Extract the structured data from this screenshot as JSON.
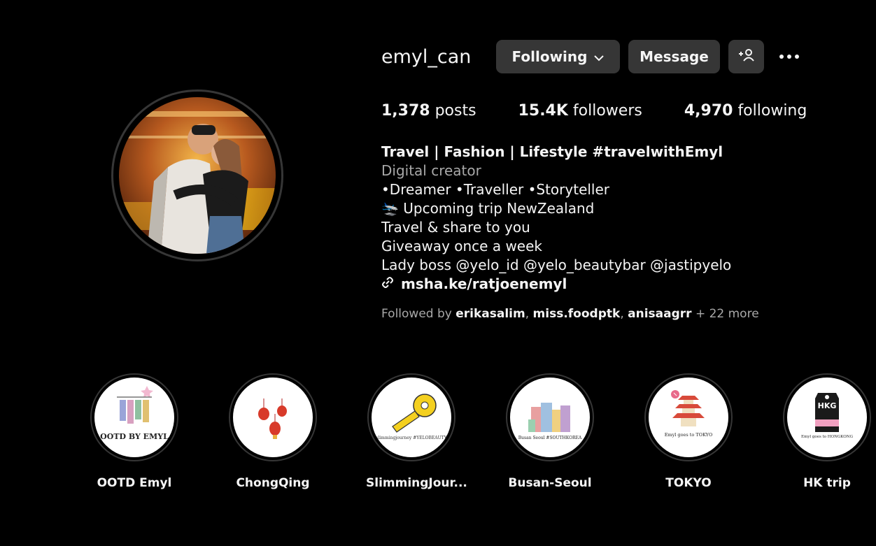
{
  "profile": {
    "username": "emyl_can",
    "following_label": "Following",
    "message_label": "Message"
  },
  "stats": {
    "posts_count": "1,378",
    "posts_label": "posts",
    "followers_count": "15.4K",
    "followers_label": "followers",
    "following_count": "4,970",
    "following_label": "following"
  },
  "bio": {
    "name": "Travel | Fashion | Lifestyle #travelwithEmyl",
    "category": "Digital creator",
    "lines": [
      "•Dreamer •Traveller •Storyteller",
      "🛬 Upcoming trip NewZealand",
      "Travel & share to you",
      "Giveaway once a week",
      "Lady boss @yelo_id @yelo_beautybar @jastipyelo"
    ],
    "link": "msha.ke/ratjoenemyl"
  },
  "followed_by": {
    "prefix": "Followed by",
    "users": [
      "erikasalim",
      "miss.foodptk",
      "anisaagrr"
    ],
    "more": "+ 22 more"
  },
  "highlights": [
    {
      "label": "OOTD Emyl",
      "cover_text": "OOTD BY EMYL"
    },
    {
      "label": "ChongQing",
      "cover_text": ""
    },
    {
      "label": "SlimmingJour...",
      "cover_text": "slimmingjourney #YELOBEAUTY"
    },
    {
      "label": "Busan-Seoul",
      "cover_text": "Busan Seoul #SOUTHKOREA"
    },
    {
      "label": "TOKYO",
      "cover_text": "Emyl goes to TOKYO"
    },
    {
      "label": "HK trip",
      "cover_text": "Emyl goes to HONGKONG"
    }
  ],
  "icons": [
    "chevron-down-icon",
    "add-person-icon",
    "more-options-icon",
    "link-icon"
  ]
}
